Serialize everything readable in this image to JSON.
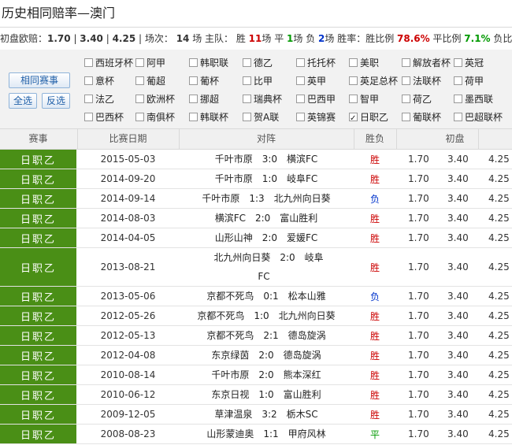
{
  "title": "历史相同赔率—澳门",
  "summary": {
    "label_init": "初盘欧赔：",
    "odds1": "1.70",
    "sep1": " | ",
    "odds2": "3.40",
    "sep2": " | ",
    "odds3": "4.25",
    "sep3": " | 场次： ",
    "count": "14",
    "count_unit": " 场  主队：",
    "win_label": " 胜 ",
    "win_count": "11",
    "win_unit": "场 平 ",
    "draw_count": "1",
    "draw_unit": "场 负 ",
    "lose_count": "2",
    "lose_unit": "场  胜率：胜比例 ",
    "win_pct": "78.6%",
    "draw_label": "  平比例 ",
    "draw_pct": "7.1%",
    "lose_label": "  负比"
  },
  "filter": {
    "same_match_btn": "相同赛事",
    "select_all_btn": "全选",
    "invert_btn": "反选",
    "leagues": [
      {
        "label": "西班牙杯",
        "checked": false
      },
      {
        "label": "阿甲",
        "checked": false
      },
      {
        "label": "韩职联",
        "checked": false
      },
      {
        "label": "德乙",
        "checked": false
      },
      {
        "label": "托托杯",
        "checked": false
      },
      {
        "label": "美职",
        "checked": false
      },
      {
        "label": "解放者杯",
        "checked": false
      },
      {
        "label": "英冠",
        "checked": false
      },
      {
        "label": "意杯",
        "checked": false
      },
      {
        "label": "葡超",
        "checked": false
      },
      {
        "label": "葡杯",
        "checked": false
      },
      {
        "label": "比甲",
        "checked": false
      },
      {
        "label": "英甲",
        "checked": false
      },
      {
        "label": "英足总杯",
        "checked": false
      },
      {
        "label": "法联杯",
        "checked": false
      },
      {
        "label": "荷甲",
        "checked": false
      },
      {
        "label": "法乙",
        "checked": false
      },
      {
        "label": "欧洲杯",
        "checked": false
      },
      {
        "label": "挪超",
        "checked": false
      },
      {
        "label": "瑞典杯",
        "checked": false
      },
      {
        "label": "巴西甲",
        "checked": false
      },
      {
        "label": "智甲",
        "checked": false
      },
      {
        "label": "荷乙",
        "checked": false
      },
      {
        "label": "墨西联",
        "checked": false
      },
      {
        "label": "巴西杯",
        "checked": false
      },
      {
        "label": "南俱杯",
        "checked": false
      },
      {
        "label": "韩联杯",
        "checked": false
      },
      {
        "label": "贺A联",
        "checked": false
      },
      {
        "label": "英锦赛",
        "checked": false
      },
      {
        "label": "日职乙",
        "checked": true
      },
      {
        "label": "葡联杯",
        "checked": false
      },
      {
        "label": "巴超联杯",
        "checked": false
      }
    ]
  },
  "table": {
    "headers": [
      "赛事",
      "比赛日期",
      "对阵",
      "胜负",
      "初盘"
    ],
    "rows": [
      {
        "league": "日职乙",
        "date": "2015-05-03",
        "home": "千叶市原",
        "score": "3:0",
        "away": "横滨FC",
        "result": "胜",
        "o1": "1.70",
        "o2": "3.40",
        "o3": "4.25"
      },
      {
        "league": "日职乙",
        "date": "2014-09-20",
        "home": "千叶市原",
        "score": "1:0",
        "away": "岐阜FC",
        "result": "胜",
        "o1": "1.70",
        "o2": "3.40",
        "o3": "4.25"
      },
      {
        "league": "日职乙",
        "date": "2014-09-14",
        "home": "千叶市原",
        "score": "1:3",
        "away": "北九州向日葵",
        "result": "负",
        "o1": "1.70",
        "o2": "3.40",
        "o3": "4.25"
      },
      {
        "league": "日职乙",
        "date": "2014-08-03",
        "home": "横滨FC",
        "score": "2:0",
        "away": "富山胜利",
        "result": "胜",
        "o1": "1.70",
        "o2": "3.40",
        "o3": "4.25"
      },
      {
        "league": "日职乙",
        "date": "2014-04-05",
        "home": "山形山神",
        "score": "2:0",
        "away": "爱媛FC",
        "result": "胜",
        "o1": "1.70",
        "o2": "3.40",
        "o3": "4.25"
      },
      {
        "league": "日职乙",
        "date": "2013-08-21",
        "home": "北九州向日葵",
        "score": "2:0",
        "away": "岐阜FC",
        "result": "胜",
        "o1": "1.70",
        "o2": "3.40",
        "o3": "4.25"
      },
      {
        "league": "日职乙",
        "date": "2013-05-06",
        "home": "京都不死鸟",
        "score": "0:1",
        "away": "松本山雅",
        "result": "负",
        "o1": "1.70",
        "o2": "3.40",
        "o3": "4.25"
      },
      {
        "league": "日职乙",
        "date": "2012-05-26",
        "home": "京都不死鸟",
        "score": "1:0",
        "away": "北九州向日葵",
        "result": "胜",
        "o1": "1.70",
        "o2": "3.40",
        "o3": "4.25"
      },
      {
        "league": "日职乙",
        "date": "2012-05-13",
        "home": "京都不死鸟",
        "score": "2:1",
        "away": "德岛旋涡",
        "result": "胜",
        "o1": "1.70",
        "o2": "3.40",
        "o3": "4.25"
      },
      {
        "league": "日职乙",
        "date": "2012-04-08",
        "home": "东京绿茵",
        "score": "2:0",
        "away": "德岛旋涡",
        "result": "胜",
        "o1": "1.70",
        "o2": "3.40",
        "o3": "4.25"
      },
      {
        "league": "日职乙",
        "date": "2010-08-14",
        "home": "千叶市原",
        "score": "2:0",
        "away": "熊本深红",
        "result": "胜",
        "o1": "1.70",
        "o2": "3.40",
        "o3": "4.25"
      },
      {
        "league": "日职乙",
        "date": "2010-06-12",
        "home": "东京日视",
        "score": "1:0",
        "away": "富山胜利",
        "result": "胜",
        "o1": "1.70",
        "o2": "3.40",
        "o3": "4.25"
      },
      {
        "league": "日职乙",
        "date": "2009-12-05",
        "home": "草津温泉",
        "score": "3:2",
        "away": "栃木SC",
        "result": "胜",
        "o1": "1.70",
        "o2": "3.40",
        "o3": "4.25"
      },
      {
        "league": "日职乙",
        "date": "2008-08-23",
        "home": "山形蒙迪奥",
        "score": "1:1",
        "away": "甲府风林",
        "result": "平",
        "o1": "1.70",
        "o2": "3.40",
        "o3": "4.25"
      }
    ]
  }
}
